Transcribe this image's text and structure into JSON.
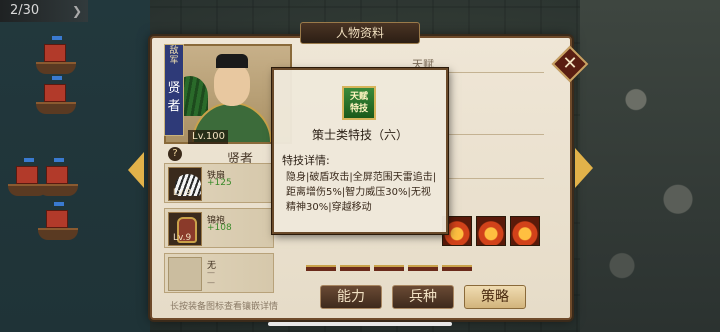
{
  "colors": {
    "panel_bg": "#efe6d6",
    "panel_border": "#6e4a2a",
    "accent_gold": "#e2b24a",
    "camp_blue": "#2e3a78",
    "active_tab": "#d2b47c"
  },
  "counter": "2/30",
  "panel": {
    "title": "人物资料",
    "close_icon": "close-icon",
    "talent_label": "天赋"
  },
  "hero": {
    "camp_label": "敌军",
    "camp_name": "贤者",
    "level": "Lv.100",
    "name": "贤者",
    "help": "?"
  },
  "equipment": [
    {
      "name": "铁扇",
      "bonus": "+125",
      "level": "Lv.9",
      "icon": "fan-icon"
    },
    {
      "name": "锦袍",
      "bonus": "+108",
      "level": "Lv.9",
      "icon": "armor-icon"
    },
    {
      "name": "无",
      "bonus": "—",
      "level": "",
      "icon": "empty-slot-icon",
      "extra": "—"
    }
  ],
  "hint": "长按装备图标查看镶嵌详情",
  "tooltip": {
    "icon_text": [
      "天赋",
      "特技"
    ],
    "title": "策士类特技（六）",
    "subtitle": "特技详情:",
    "lines": [
      "隐身|破盾攻击|全屏范围天雷追击|",
      "距离增伤5%|智力威压30%|无视",
      "精神30%|穿越移动"
    ]
  },
  "tabs": [
    {
      "label": "能力",
      "active": false
    },
    {
      "label": "兵种",
      "active": false
    },
    {
      "label": "策略",
      "active": true
    }
  ]
}
